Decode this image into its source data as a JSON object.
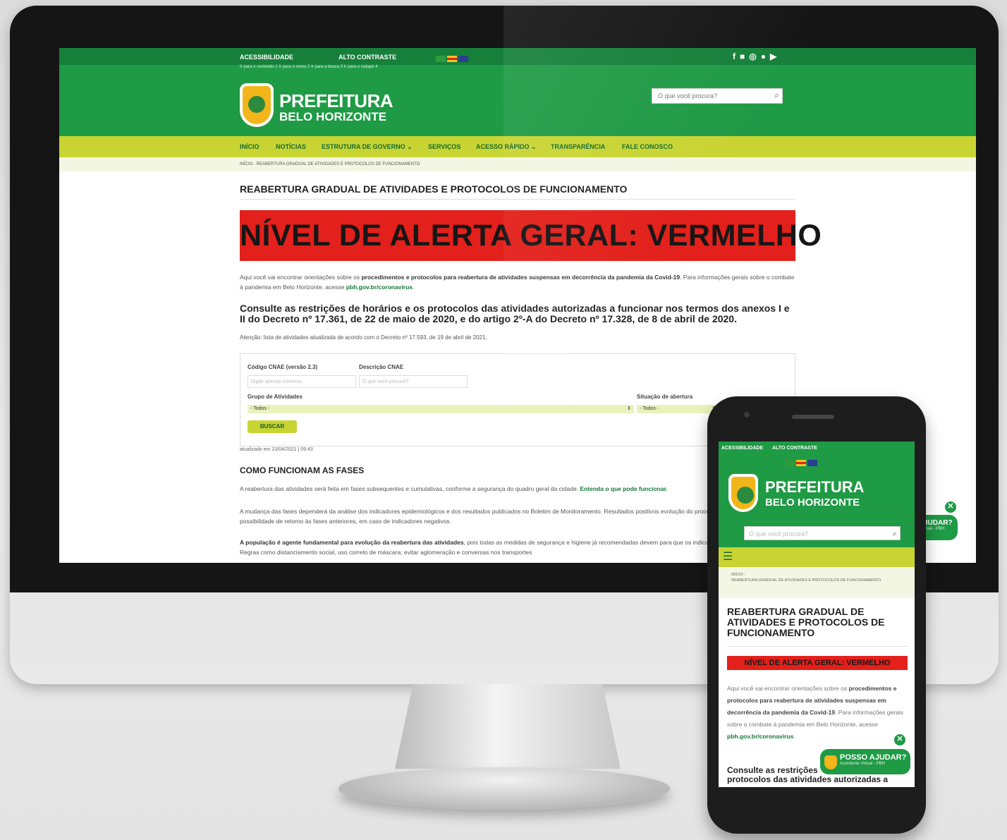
{
  "desktop": {
    "util": {
      "accessibility": "ACESSIBILIDADE",
      "contrast": "ALTO CONTRASTE"
    },
    "skip_links": "Ir para o conteúdo 1  Ir para o menu 2  Ir para a busca 3  Ir para o rodapé 4",
    "social_icons": [
      "facebook-icon",
      "twitter-icon",
      "instagram-icon",
      "flickr-icon",
      "youtube-icon"
    ],
    "logo": {
      "line1": "PREFEITURA",
      "line2": "BELO HORIZONTE"
    },
    "search": {
      "placeholder": "O que você procura?"
    },
    "nav": [
      "INÍCIO",
      "NOTÍCIAS",
      "ESTRUTURA DE GOVERNO ⌄",
      "SERVIÇOS",
      "ACESSO RÁPIDO ⌄",
      "TRANSPARÊNCIA",
      "FALE CONOSCO"
    ],
    "breadcrumb": "INÍCIO - REABERTURA GRADUAL DE ATIVIDADES E PROTOCOLOS DE FUNCIONAMENTO",
    "title": "REABERTURA GRADUAL DE ATIVIDADES E PROTOCOLOS DE FUNCIONAMENTO",
    "alert": "NÍVEL DE ALERTA GERAL: VERMELHO",
    "intro_a": "Aqui você vai encontrar orientações sobre os ",
    "intro_b": "procedimentos e protocolos para reabertura de atividades suspensas em decorrência da pandemia da Covid-19",
    "intro_c": ". Para informações gerais sobre o combate à pandemia em Belo Horizonte, acesse ",
    "intro_link": "pbh.gov.br/coronavirus",
    "heading": "Consulte as restrições de horários e os protocolos das atividades autorizadas a funcionar nos termos dos anexos I e II do Decreto nº 17.361, de 22 de maio de 2020, e do artigo 2º-A do Decreto nº 17.328, de 8 de abril de 2020.",
    "attention": "Atenção: lista de atividades atualizada de acordo com o Decreto nº 17.593, de 19 de abril de 2021.",
    "form": {
      "cnae_label": "Código CNAE (versão 2.3)",
      "cnae_placeholder": "Digite apenas números",
      "desc_label": "Descrição CNAE",
      "desc_placeholder": "O que você procura?",
      "group_label": "Grupo de Atividades",
      "group_value": "- Todos -",
      "status_label": "Situação de abertura",
      "status_value": "- Todos -",
      "button": "BUSCAR"
    },
    "updated": "atualizado em 23/04/2021 | 09:43",
    "phases_title": "COMO FUNCIONAM AS FASES",
    "phases_p1": "A reabertura das atividades será feita em fases subsequentes e cumulativas, conforme a segurança do quadro geral da cidade. ",
    "phases_p1_link": "Entenda o que pode funcionar.",
    "phases_p2": "A mudança das fases dependerá da análise dos indicadores epidemiológicos e dos resultados publicados no Boletim de Monitoramento. Resultados positivos evolução do processo. Da mesma forma, existe a possibilidade de retorno às fases anteriores, em caso de indicadores negativos.",
    "phases_p3_b": "A população é agente fundamental para evolução da reabertura das atividades",
    "phases_p3": ", pois todas as medidas de segurança e higiene já recomendadas devem para que os indicadores permaneçam estáveis. Regras como distanciamento social, uso correto de máscara; evitar aglomeração e conversas nos transportes"
  },
  "phone": {
    "util": {
      "accessibility": "ACESSIBILIDADE",
      "contrast": "ALTO CONTRASTE"
    },
    "logo": {
      "line1": "PREFEITURA",
      "line2": "BELO HORIZONTE"
    },
    "search": {
      "placeholder": "O que você procura?"
    },
    "breadcrumb_home": "INÍCIO -",
    "breadcrumb_page": "REABERTURA GRADUAL DE ATIVIDADES E PROTOCOLOS DE FUNCIONAMENTO",
    "title": "REABERTURA GRADUAL DE ATIVIDADES E PROTOCOLOS DE FUNCIONAMENTO",
    "alert": "NÍVEL DE ALERTA GERAL: VERMELHO",
    "intro_a": "Aqui você vai encontrar orientações sobre os ",
    "intro_b": "procedimentos e protocolos para reabertura de atividades suspensas em decorrência da pandemia da Covid-19",
    "intro_c": ". Para informações gerais sobre o combate à pandemia em Belo Horizonte, acesse ",
    "intro_link": "pbh.gov.br/coronavirus",
    "heading": "Consulte as restrições de horários e os protocolos das atividades autorizadas a"
  },
  "chat": {
    "label": "POSSO AJUDAR?",
    "sub": "Assistente Virtual - PBH",
    "partial_label": "JUDAR?",
    "partial_sub": "rtual - PBH"
  },
  "colors": {
    "brand_green": "#1f9a45",
    "nav_lime": "#c8d431",
    "alert_red": "#e3201b"
  }
}
